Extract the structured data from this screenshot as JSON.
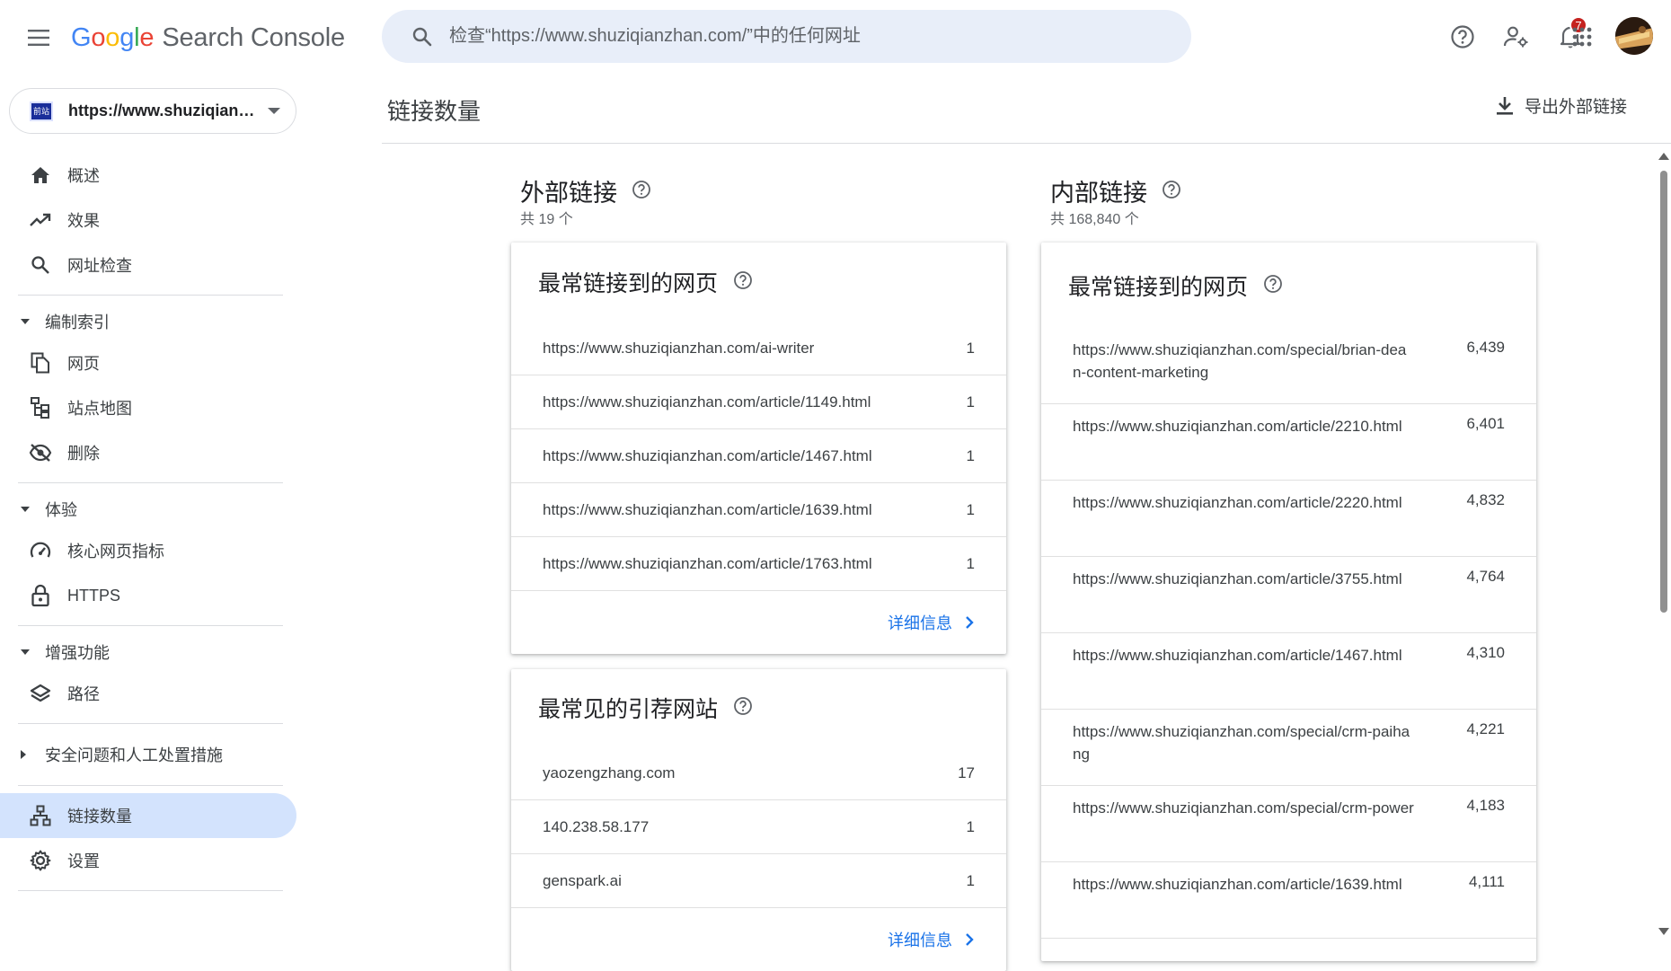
{
  "app": {
    "logo_letters": [
      "G",
      "o",
      "o",
      "g",
      "l",
      "e"
    ],
    "product": "Search Console"
  },
  "search": {
    "placeholder": "检查“https://www.shuziqianzhan.com/”中的任何网址"
  },
  "topbar": {
    "notification_count": "7"
  },
  "property": {
    "url": "https://www.shuziqianzhan.com/",
    "favicon_text": "前站"
  },
  "sidebar": {
    "overview": "概述",
    "performance": "效果",
    "url_inspection": "网址检查",
    "indexing_section": "编制索引",
    "pages": "网页",
    "sitemaps": "站点地图",
    "removals": "删除",
    "experience_section": "体验",
    "core_web_vitals": "核心网页指标",
    "https": "HTTPS",
    "enhancements_section": "增强功能",
    "breadcrumbs": "路径",
    "security_section": "安全问题和人工处置措施",
    "links": "链接数量",
    "settings": "设置"
  },
  "header": {
    "title": "链接数量",
    "export_label": "导出外部链接"
  },
  "external": {
    "title": "外部链接",
    "total": "共 19 个",
    "top_linked_pages": {
      "title": "最常链接到的网页",
      "rows": [
        {
          "url": "https://www.shuziqianzhan.com/ai-writer",
          "count": "1"
        },
        {
          "url": "https://www.shuziqianzhan.com/article/1149.html",
          "count": "1"
        },
        {
          "url": "https://www.shuziqianzhan.com/article/1467.html",
          "count": "1"
        },
        {
          "url": "https://www.shuziqianzhan.com/article/1639.html",
          "count": "1"
        },
        {
          "url": "https://www.shuziqianzhan.com/article/1763.html",
          "count": "1"
        }
      ],
      "more": "详细信息"
    },
    "top_linking_sites": {
      "title": "最常见的引荐网站",
      "rows": [
        {
          "url": "yaozengzhang.com",
          "count": "17"
        },
        {
          "url": "140.238.58.177",
          "count": "1"
        },
        {
          "url": "genspark.ai",
          "count": "1"
        }
      ],
      "more": "详细信息"
    }
  },
  "internal": {
    "title": "内部链接",
    "total": "共 168,840 个",
    "top_linked_pages": {
      "title": "最常链接到的网页",
      "rows": [
        {
          "url": "https://www.shuziqianzhan.com/special/brian-dean-content-marketing",
          "count": "6,439"
        },
        {
          "url": "https://www.shuziqianzhan.com/article/2210.html",
          "count": "6,401"
        },
        {
          "url": "https://www.shuziqianzhan.com/article/2220.html",
          "count": "4,832"
        },
        {
          "url": "https://www.shuziqianzhan.com/article/3755.html",
          "count": "4,764"
        },
        {
          "url": "https://www.shuziqianzhan.com/article/1467.html",
          "count": "4,310"
        },
        {
          "url": "https://www.shuziqianzhan.com/special/crm-paihang",
          "count": "4,221"
        },
        {
          "url": "https://www.shuziqianzhan.com/special/crm-power",
          "count": "4,183"
        },
        {
          "url": "https://www.shuziqianzhan.com/article/1639.html",
          "count": "4,111"
        }
      ]
    }
  },
  "colors": {
    "accent": "#1a73e8",
    "active_nav": "#d3e3fd",
    "search_bg": "#e8eef9",
    "badge": "#c5221f"
  }
}
